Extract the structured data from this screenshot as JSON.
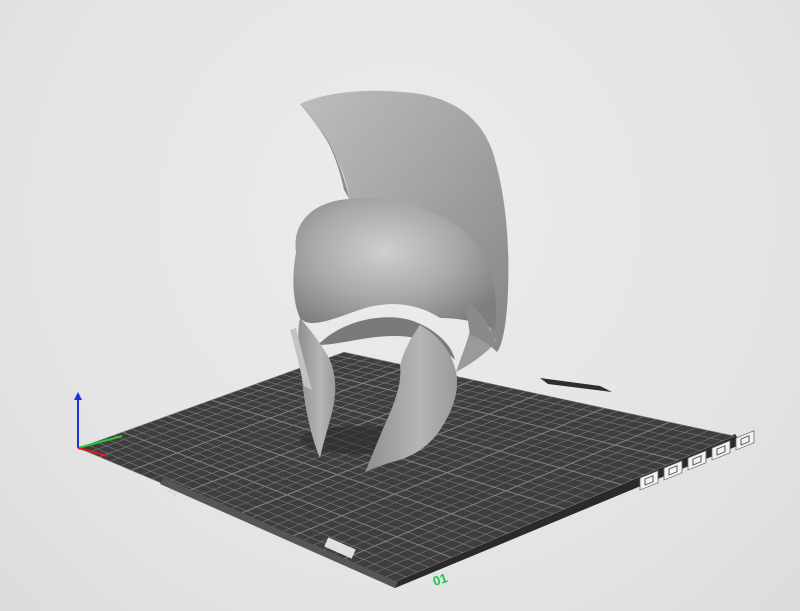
{
  "viewport": {
    "background": "#e6e6e6",
    "bed_color": "#3e3e3e",
    "grid_color": "#8a8a8a",
    "model_color": "#a8a8a8"
  },
  "bed": {
    "front_label": "01"
  },
  "axes": {
    "x_color": "#d81e1e",
    "y_color": "#2cc43a",
    "z_color": "#1f2fd6"
  },
  "bed_icons": [
    {
      "name": "settings-icon"
    },
    {
      "name": "cube-icon"
    },
    {
      "name": "layers-icon"
    },
    {
      "name": "copy-icon"
    },
    {
      "name": "delete-icon"
    }
  ]
}
